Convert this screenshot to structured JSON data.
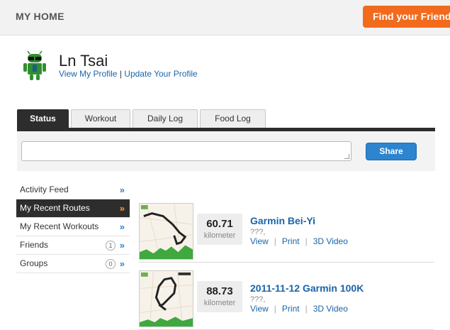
{
  "header": {
    "title": "MY HOME",
    "find_friends_label": "Find your Friends"
  },
  "profile": {
    "name": "Ln Tsai",
    "view_link": "View My Profile",
    "separator": "|",
    "update_link": "Update Your Profile"
  },
  "tabs": [
    {
      "label": "Status"
    },
    {
      "label": "Workout"
    },
    {
      "label": "Daily Log"
    },
    {
      "label": "Food Log"
    }
  ],
  "status": {
    "share_label": "Share",
    "placeholder": ""
  },
  "sidebar": {
    "items": [
      {
        "label": "Activity Feed",
        "chevron": "»"
      },
      {
        "label": "My Recent Routes",
        "chevron": "»"
      },
      {
        "label": "My Recent Workouts",
        "chevron": "»"
      },
      {
        "label": "Friends",
        "count": "1",
        "chevron": "»"
      },
      {
        "label": "Groups",
        "count": "0",
        "chevron": "»"
      }
    ]
  },
  "routes": [
    {
      "distance": "60.71",
      "unit": "kilometer",
      "name": "Garmin Bei-Yi",
      "subtitle": "???,",
      "actions": {
        "view": "View",
        "print": "Print",
        "video": "3D Video",
        "sep": "|"
      }
    },
    {
      "distance": "88.73",
      "unit": "kilometer",
      "name": "2011-11-12 Garmin 100K",
      "subtitle": "???,",
      "actions": {
        "view": "View",
        "print": "Print",
        "video": "3D Video",
        "sep": "|"
      }
    }
  ],
  "colors": {
    "accent_orange": "#f26a1b",
    "link_blue": "#1a64a8",
    "share_blue": "#2d84cf",
    "dark_bar": "#2d2d2d"
  }
}
